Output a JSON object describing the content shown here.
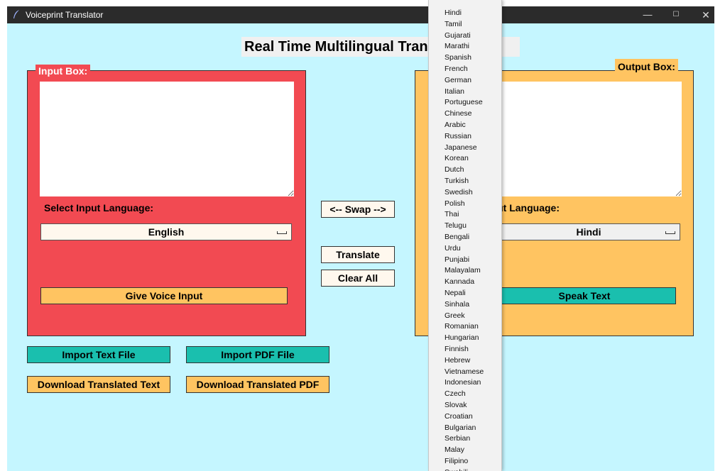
{
  "window": {
    "title": "Voiceprint Translator",
    "controls": {
      "minimize": "—",
      "maximize": "☐",
      "close": "✕"
    }
  },
  "heading": "Real Time Multilingual Translator",
  "input_box": {
    "label": "Input Box:",
    "text": "",
    "language_label": "Select Input Language:",
    "selected_language": "English",
    "voice_button": "Give Voice Input"
  },
  "output_box": {
    "label": "Output Box:",
    "text": "",
    "language_label": "Select Output Language:",
    "selected_language": "Hindi",
    "speak_button": "Speak Text"
  },
  "center_buttons": {
    "swap": "<-- Swap -->",
    "translate": "Translate",
    "clear": "Clear All"
  },
  "file_buttons": {
    "import_text": "Import Text File",
    "import_pdf": "Import PDF File",
    "download_text": "Download Translated Text",
    "download_pdf": "Download Translated PDF"
  },
  "language_dropdown": [
    "Hindi",
    "Tamil",
    "Gujarati",
    "Marathi",
    "Spanish",
    "French",
    "German",
    "Italian",
    "Portuguese",
    "Chinese",
    "Arabic",
    "Russian",
    "Japanese",
    "Korean",
    "Dutch",
    "Turkish",
    "Swedish",
    "Polish",
    "Thai",
    "Telugu",
    "Bengali",
    "Urdu",
    "Punjabi",
    "Malayalam",
    "Kannada",
    "Nepali",
    "Sinhala",
    "Greek",
    "Romanian",
    "Hungarian",
    "Finnish",
    "Hebrew",
    "Vietnamese",
    "Indonesian",
    "Czech",
    "Slovak",
    "Croatian",
    "Bulgarian",
    "Serbian",
    "Malay",
    "Filipino",
    "Swahili"
  ],
  "colors": {
    "background": "#c5f6ff",
    "input_frame": "#f24a52",
    "output_frame": "#ffc461",
    "teal_button": "#1abfae"
  }
}
